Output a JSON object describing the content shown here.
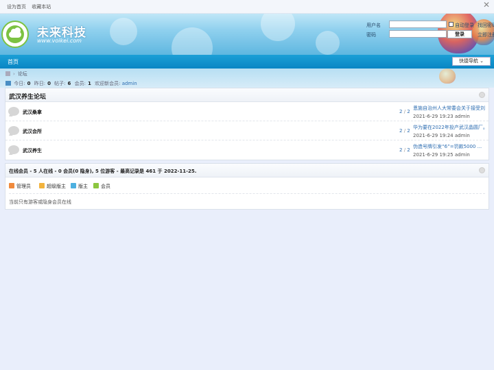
{
  "topbar": {
    "links": [
      "设为首页",
      "收藏本站"
    ]
  },
  "header": {
    "logo_name": "未来科技",
    "logo_url": "www.voikei.com"
  },
  "login": {
    "username_label": "用户名",
    "password_label": "密码",
    "auto_login": "自动登录",
    "retrieve_password": "找回密码",
    "login_button": "登录",
    "register": "立即注册"
  },
  "nav": {
    "home": "首页",
    "quick_nav": "快捷导航 ⌄"
  },
  "breadcrumb": {
    "forum": "论坛"
  },
  "stats": {
    "today_label": "今日:",
    "today": "0",
    "yesterday_label": "昨日:",
    "yesterday": "0",
    "posts_label": "帖子:",
    "posts": "6",
    "members_label": "会员:",
    "members": "1",
    "newest_label": "欢迎新会员:",
    "newest_member": "admin"
  },
  "forum_section": {
    "title": "武汉养生论坛",
    "forums": [
      {
        "name": "武汉桑拿",
        "threads": "2",
        "posts": "2",
        "last_title": "恩施自治州人大常委会关于接受刘 ...",
        "last_meta": "2021-6-29 19:23 admin"
      },
      {
        "name": "武汉会所",
        "threads": "2",
        "posts": "2",
        "last_title": "华为要在2022年投产武汉晶圆厂。...",
        "last_meta": "2021-6-29 19:24 admin"
      },
      {
        "name": "武汉养生",
        "threads": "2",
        "posts": "2",
        "last_title": "伪造号牌引发“6”=罚款5000 ...",
        "last_meta": "2021-6-29 19:25 admin"
      }
    ]
  },
  "online": {
    "title": "在线会员 - 5 人在线 - 0 会员(0 隐身), 5 位游客 - 最高记录是 461 于 2022-11-25.",
    "legend": [
      "管理员",
      "超级版主",
      "版主",
      "会员"
    ],
    "note": "当前只有游客或隐身会员在线"
  },
  "colors": {
    "nav_blue": "#0a86c4",
    "link_blue": "#2a6bb0",
    "logo_green": "#7cc242",
    "admin_icon": "#f08a3c",
    "super_mod_icon": "#f2b33d",
    "mod_icon": "#4db0e0",
    "member_icon": "#8cc63f"
  }
}
